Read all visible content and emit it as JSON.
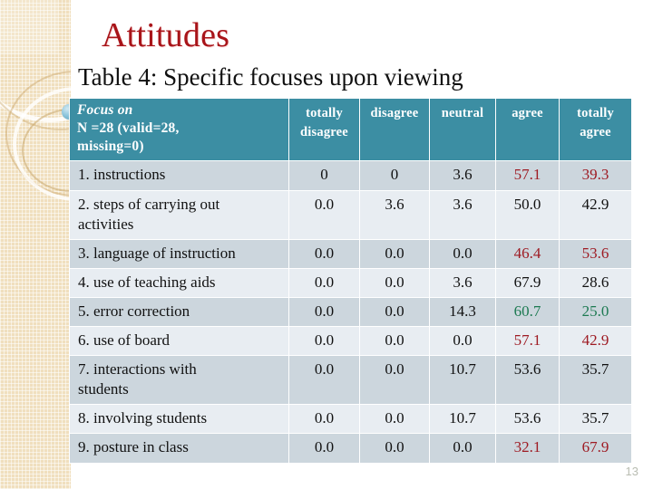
{
  "slide": {
    "title": "Attitudes",
    "subtitle": "Table 4: Specific focuses upon viewing",
    "page_number": "13",
    "title_color": "#a81419",
    "header_bg_color": "#3c8ea3",
    "band_a_color": "#ccd6dd",
    "band_b_color": "#e8edf2",
    "highlight_red": "#9e1b23",
    "highlight_green": "#1d7a52",
    "decor_band_color": "#f0dfbe"
  },
  "table": {
    "corner_header": {
      "line1": "Focus on",
      "line2": "N =28 (valid=28,",
      "line3": "missing=0)"
    },
    "columns": [
      "totally disagree",
      "disagree",
      "neutral",
      "agree",
      "totally agree"
    ],
    "rows": [
      {
        "label": "1.  instructions",
        "band": "a",
        "values": [
          "0",
          "0",
          "3.6",
          "57.1",
          "39.3"
        ],
        "colors": [
          "black",
          "black",
          "black",
          "red",
          "red"
        ]
      },
      {
        "label": "2. steps of carrying out\n    activities",
        "band": "b",
        "values": [
          "0.0",
          "3.6",
          "3.6",
          "50.0",
          "42.9"
        ],
        "colors": [
          "black",
          "black",
          "black",
          "black",
          "black"
        ]
      },
      {
        "label": "3. language of instruction",
        "band": "a",
        "values": [
          "0.0",
          "0.0",
          "0.0",
          "46.4",
          "53.6"
        ],
        "colors": [
          "black",
          "black",
          "black",
          "red",
          "red"
        ]
      },
      {
        "label": "4. use of teaching aids",
        "band": "b",
        "values": [
          "0.0",
          "0.0",
          "3.6",
          "67.9",
          "28.6"
        ],
        "colors": [
          "black",
          "black",
          "black",
          "black",
          "black"
        ]
      },
      {
        "label": "5. error correction",
        "band": "a",
        "values": [
          "0.0",
          "0.0",
          "14.3",
          "60.7",
          "25.0"
        ],
        "colors": [
          "black",
          "black",
          "black",
          "green",
          "green"
        ]
      },
      {
        "label": "6. use of board",
        "band": "b",
        "values": [
          "0.0",
          "0.0",
          "0.0",
          "57.1",
          "42.9"
        ],
        "colors": [
          "black",
          "black",
          "black",
          "red",
          "red"
        ]
      },
      {
        "label": "7. interactions with\n     students",
        "band": "a",
        "values": [
          "0.0",
          "0.0",
          "10.7",
          "53.6",
          "35.7"
        ],
        "colors": [
          "black",
          "black",
          "black",
          "black",
          "black"
        ]
      },
      {
        "label": "8. involving students",
        "band": "b",
        "values": [
          "0.0",
          "0.0",
          "10.7",
          "53.6",
          "35.7"
        ],
        "colors": [
          "black",
          "black",
          "black",
          "black",
          "black"
        ]
      },
      {
        "label": "9. posture in class",
        "band": "a",
        "values": [
          "0.0",
          "0.0",
          "0.0",
          "32.1",
          "67.9"
        ],
        "colors": [
          "black",
          "black",
          "black",
          "red",
          "red"
        ]
      }
    ]
  }
}
